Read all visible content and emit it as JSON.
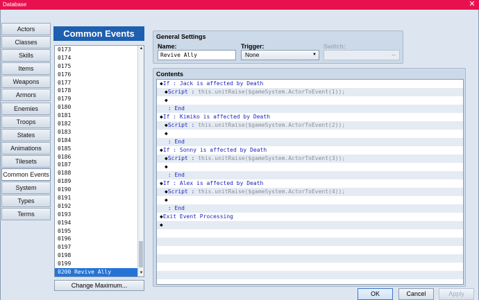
{
  "window": {
    "title": "Database",
    "close_glyph": "✕"
  },
  "nav": {
    "items": [
      "Actors",
      "Classes",
      "Skills",
      "Items",
      "Weapons",
      "Armors",
      "Enemies",
      "Troops",
      "States",
      "Animations",
      "Tilesets",
      "Common Events",
      "System",
      "Types",
      "Terms"
    ],
    "active": "Common Events"
  },
  "common_events": {
    "header": "Common Events",
    "rows": [
      "0173",
      "0174",
      "0175",
      "0176",
      "0177",
      "0178",
      "0179",
      "0180",
      "0181",
      "0182",
      "0183",
      "0184",
      "0185",
      "0186",
      "0187",
      "0188",
      "0189",
      "0190",
      "0191",
      "0192",
      "0193",
      "0194",
      "0195",
      "0196",
      "0197",
      "0198",
      "0199",
      "0200 Revive Ally"
    ],
    "selected": "0200 Revive Ally",
    "change_max_label": "Change Maximum..."
  },
  "general": {
    "title": "General Settings",
    "name_label": "Name:",
    "name_value": "Revive Ally",
    "trigger_label": "Trigger:",
    "trigger_value": "None",
    "switch_label": "Switch:",
    "switch_button": "..."
  },
  "contents": {
    "title": "Contents",
    "cmd_rows": [
      {
        "indent": 0,
        "diamond": "◆",
        "keyword": "If",
        "sep": " : ",
        "text": "Jack is affected by Death",
        "text_style": "blue"
      },
      {
        "indent": 1,
        "diamond": "◆",
        "keyword": "Script",
        "sep": " : ",
        "text": "this.unitRaise($gameSystem.ActorToEvent(1));",
        "text_style": "gray"
      },
      {
        "indent": 1,
        "diamond": "◆",
        "keyword": "",
        "sep": "",
        "text": "",
        "text_style": "blue"
      },
      {
        "indent": 0,
        "diamond": "",
        "keyword": "",
        "sep": " : ",
        "text": "End",
        "text_style": "blue"
      },
      {
        "indent": 0,
        "diamond": "◆",
        "keyword": "If",
        "sep": " : ",
        "text": "Kimiko is affected by Death",
        "text_style": "blue"
      },
      {
        "indent": 1,
        "diamond": "◆",
        "keyword": "Script",
        "sep": " : ",
        "text": "this.unitRaise($gameSystem.ActorToEvent(2));",
        "text_style": "gray"
      },
      {
        "indent": 1,
        "diamond": "◆",
        "keyword": "",
        "sep": "",
        "text": "",
        "text_style": "blue"
      },
      {
        "indent": 0,
        "diamond": "",
        "keyword": "",
        "sep": " : ",
        "text": "End",
        "text_style": "blue"
      },
      {
        "indent": 0,
        "diamond": "◆",
        "keyword": "If",
        "sep": " : ",
        "text": "Sonny is affected by Death",
        "text_style": "blue"
      },
      {
        "indent": 1,
        "diamond": "◆",
        "keyword": "Script",
        "sep": " : ",
        "text": "this.unitRaise($gameSystem.ActorToEvent(3));",
        "text_style": "gray"
      },
      {
        "indent": 1,
        "diamond": "◆",
        "keyword": "",
        "sep": "",
        "text": "",
        "text_style": "blue"
      },
      {
        "indent": 0,
        "diamond": "",
        "keyword": "",
        "sep": " : ",
        "text": "End",
        "text_style": "blue"
      },
      {
        "indent": 0,
        "diamond": "◆",
        "keyword": "If",
        "sep": " : ",
        "text": "Alex is affected by Death",
        "text_style": "blue"
      },
      {
        "indent": 1,
        "diamond": "◆",
        "keyword": "Script",
        "sep": " : ",
        "text": "this.unitRaise($gameSystem.ActorToEvent(4));",
        "text_style": "gray"
      },
      {
        "indent": 1,
        "diamond": "◆",
        "keyword": "",
        "sep": "",
        "text": "",
        "text_style": "blue"
      },
      {
        "indent": 0,
        "diamond": "",
        "keyword": "",
        "sep": " : ",
        "text": "End",
        "text_style": "blue"
      },
      {
        "indent": 0,
        "diamond": "◆",
        "keyword": "Exit Event Processing",
        "sep": "",
        "text": "",
        "text_style": "blue"
      },
      {
        "indent": 0,
        "diamond": "◆",
        "keyword": "",
        "sep": "",
        "text": "",
        "text_style": "blue"
      }
    ]
  },
  "buttons": {
    "ok": "OK",
    "cancel": "Cancel",
    "apply": "Apply"
  },
  "colors": {
    "titlebar": "#e8114f",
    "header": "#1f5fb0",
    "selection": "#2474d6",
    "keyword": "#1a25c0",
    "script_text": "#8a8f96"
  }
}
